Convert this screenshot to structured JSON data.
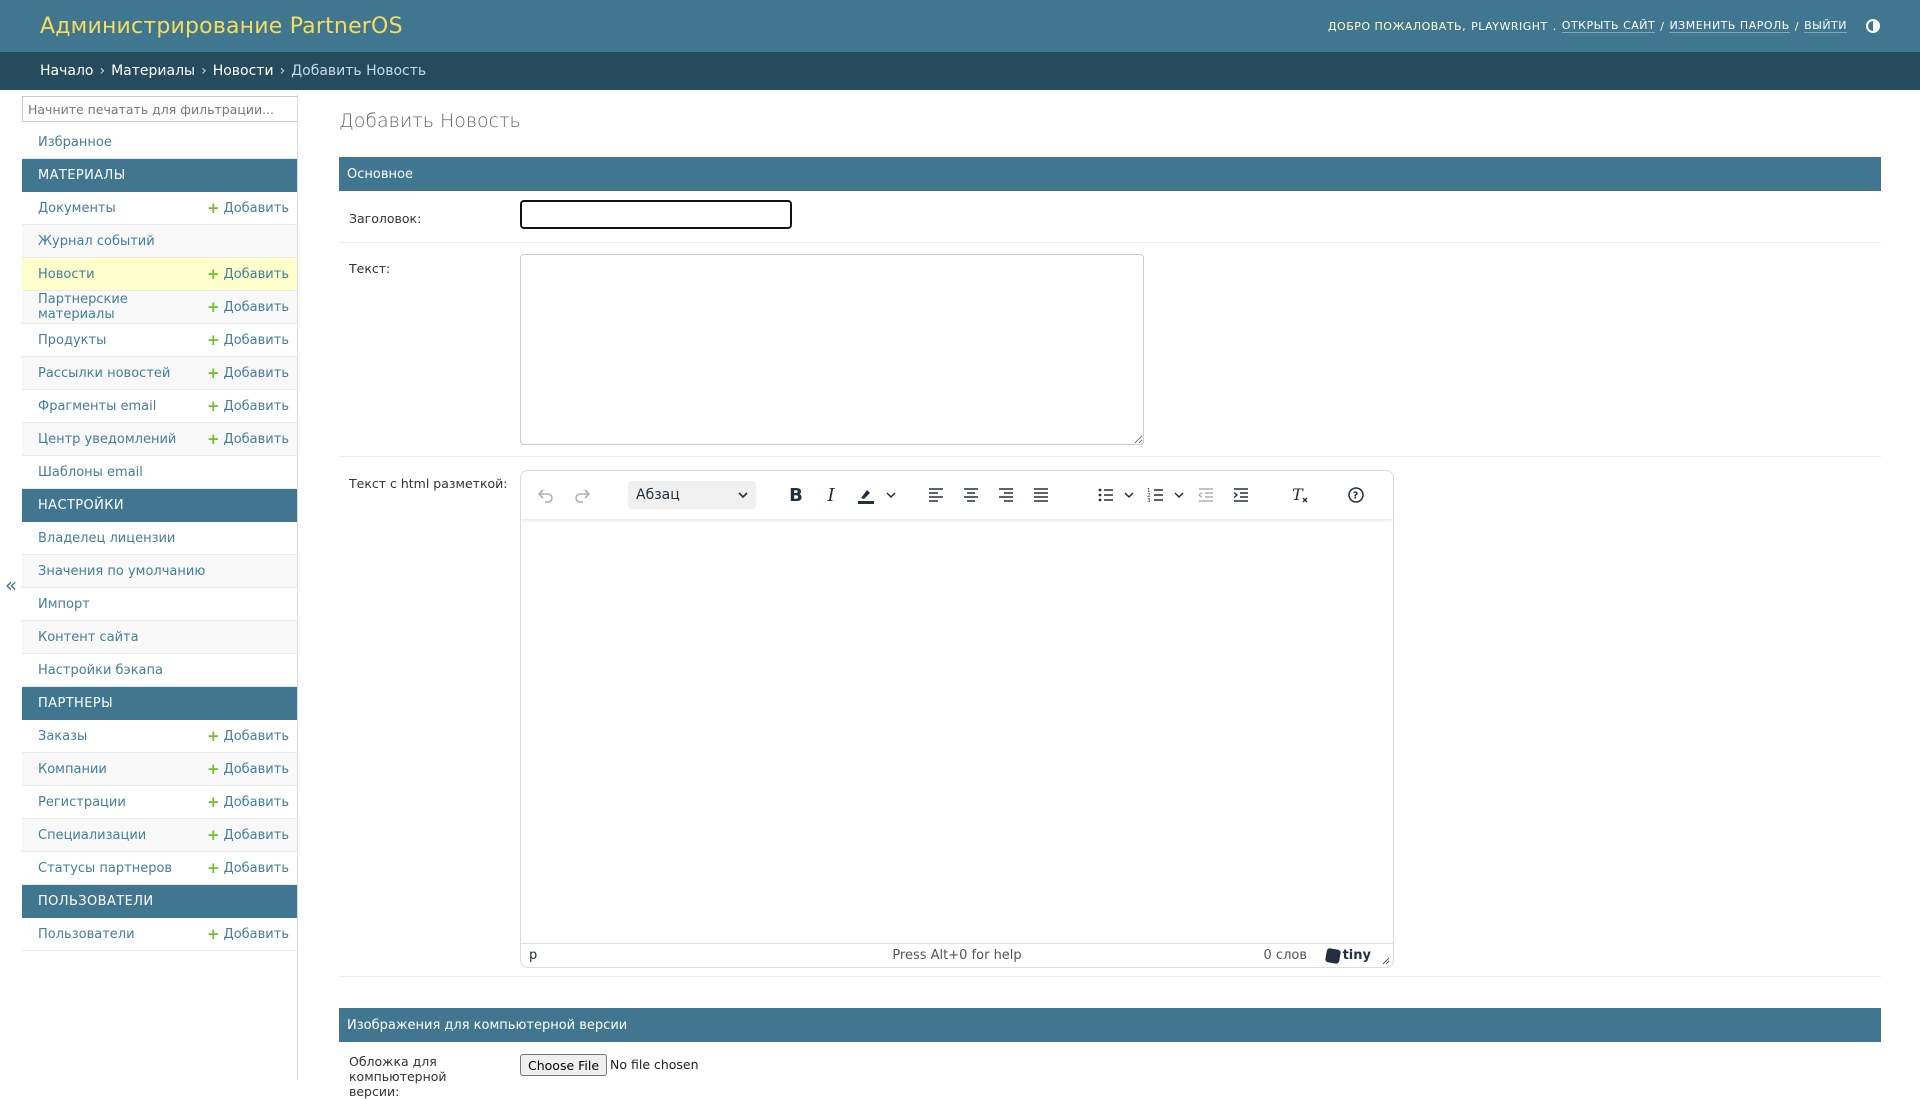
{
  "header": {
    "site_name": "Администрирование PartnerOS",
    "welcome": "ДОБРО ПОЖАЛОВАТЬ,",
    "username": "PLAYWRIGHT",
    "welcome_dot": ".",
    "view_site": "ОТКРЫТЬ САЙТ",
    "change_password": "ИЗМЕНИТЬ ПАРОЛЬ",
    "logout": "ВЫЙТИ",
    "separator": "/"
  },
  "breadcrumbs": {
    "items": [
      "Начало",
      "Материалы",
      "Новости"
    ],
    "current": "Добавить Новость",
    "arrow": "›"
  },
  "toggle_nav_label": "«",
  "sidebar": {
    "filter_placeholder": "Начните печатать для фильтрации...",
    "favorites": "Избранное",
    "add_label": "Добавить",
    "sections": [
      {
        "title": "МАТЕРИАЛЫ",
        "items": [
          {
            "label": "Документы",
            "add": true
          },
          {
            "label": "Журнал событий",
            "add": false
          },
          {
            "label": "Новости",
            "add": true,
            "current": true
          },
          {
            "label": "Партнерские материалы",
            "add": true
          },
          {
            "label": "Продукты",
            "add": true
          },
          {
            "label": "Рассылки новостей",
            "add": true
          },
          {
            "label": "Фрагменты email",
            "add": true
          },
          {
            "label": "Центр уведомлений",
            "add": true
          },
          {
            "label": "Шаблоны email",
            "add": false
          }
        ]
      },
      {
        "title": "НАСТРОЙКИ",
        "items": [
          {
            "label": "Владелец лицензии",
            "add": false
          },
          {
            "label": "Значения по умолчанию",
            "add": false
          },
          {
            "label": "Импорт",
            "add": false
          },
          {
            "label": "Контент сайта",
            "add": false
          },
          {
            "label": "Настройки бэкапа",
            "add": false
          }
        ]
      },
      {
        "title": "ПАРТНЕРЫ",
        "items": [
          {
            "label": "Заказы",
            "add": true
          },
          {
            "label": "Компании",
            "add": true
          },
          {
            "label": "Регистрации",
            "add": true
          },
          {
            "label": "Специализации",
            "add": true
          },
          {
            "label": "Статусы партнеров",
            "add": true
          }
        ]
      },
      {
        "title": "ПОЛЬЗОВАТЕЛИ",
        "items": [
          {
            "label": "Пользователи",
            "add": true
          }
        ]
      }
    ]
  },
  "content": {
    "page_title": "Добавить Новость",
    "fieldset_main": "Основное",
    "title_label": "Заголовок:",
    "title_value": "",
    "text_label": "Текст:",
    "text_value": "",
    "html_label": "Текст с html разметкой:",
    "editor": {
      "block_format": "Абзац",
      "status_path": "p",
      "help_text": "Press Alt+0 for help",
      "word_count": "0 слов",
      "brand": "tiny",
      "toolbar_icons": [
        "undo-icon",
        "redo-icon",
        "bold-icon",
        "italic-icon",
        "highlight-color-icon",
        "align-left-icon",
        "align-center-icon",
        "align-right-icon",
        "align-justify-icon",
        "bullet-list-icon",
        "numbered-list-icon",
        "outdent-icon",
        "indent-icon",
        "clear-formatting-icon",
        "help-icon"
      ]
    },
    "fieldset_images": "Изображения для компьютерной версии",
    "cover_label": "Обложка для компьютерной версии:",
    "choose_file": "Choose File",
    "no_file": "No file chosen"
  },
  "colors": {
    "header_bg": "#417690",
    "breadcrumbs_bg": "#264b5d",
    "site_name": "#f5dd5d",
    "link": "#447e9b",
    "add_plus": "#70bf2b",
    "current_row": "#ffffcc"
  }
}
